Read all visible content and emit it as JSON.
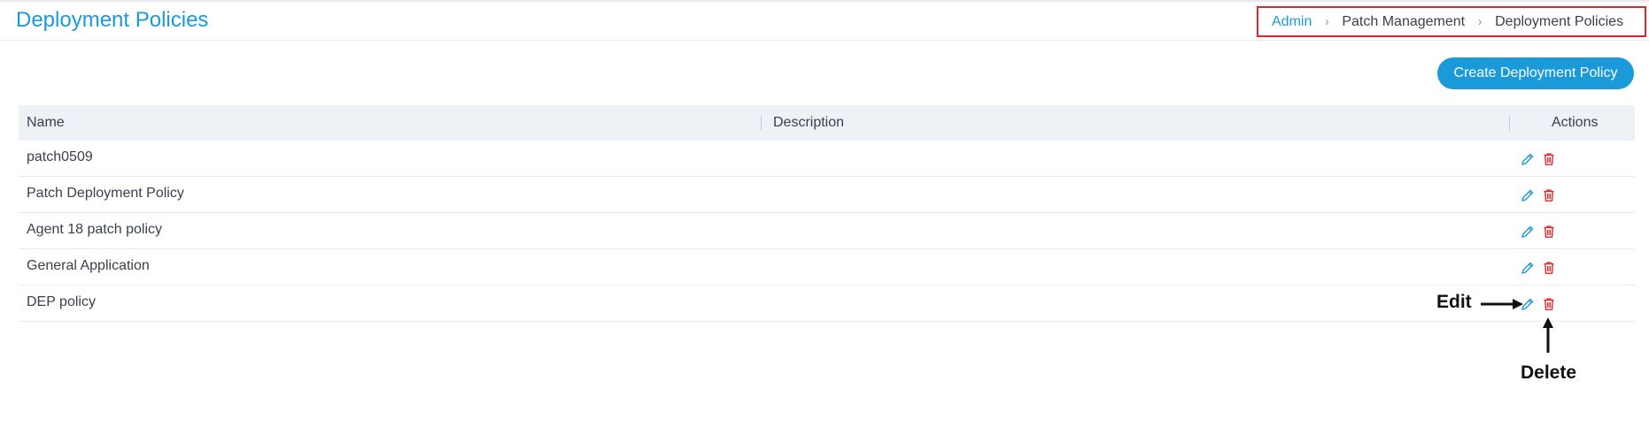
{
  "page": {
    "title": "Deployment Policies"
  },
  "breadcrumb": {
    "items": [
      {
        "label": "Admin"
      },
      {
        "label": "Patch Management"
      },
      {
        "label": "Deployment Policies"
      }
    ],
    "separator": "›"
  },
  "toolbar": {
    "create_label": "Create Deployment Policy"
  },
  "table": {
    "columns": [
      "Name",
      "Description",
      "Actions"
    ],
    "rows": [
      {
        "name": "patch0509",
        "description": ""
      },
      {
        "name": "Patch Deployment Policy",
        "description": ""
      },
      {
        "name": "Agent 18 patch policy",
        "description": ""
      },
      {
        "name": "General Application",
        "description": ""
      },
      {
        "name": "DEP policy",
        "description": ""
      }
    ],
    "action_icons": [
      "pencil-icon",
      "trash-icon"
    ]
  },
  "annotations": {
    "edit": "Edit",
    "delete": "Delete"
  },
  "colors": {
    "accent": "#1a9ad9",
    "danger": "#e0262b",
    "header_bg": "#eef1f5"
  }
}
